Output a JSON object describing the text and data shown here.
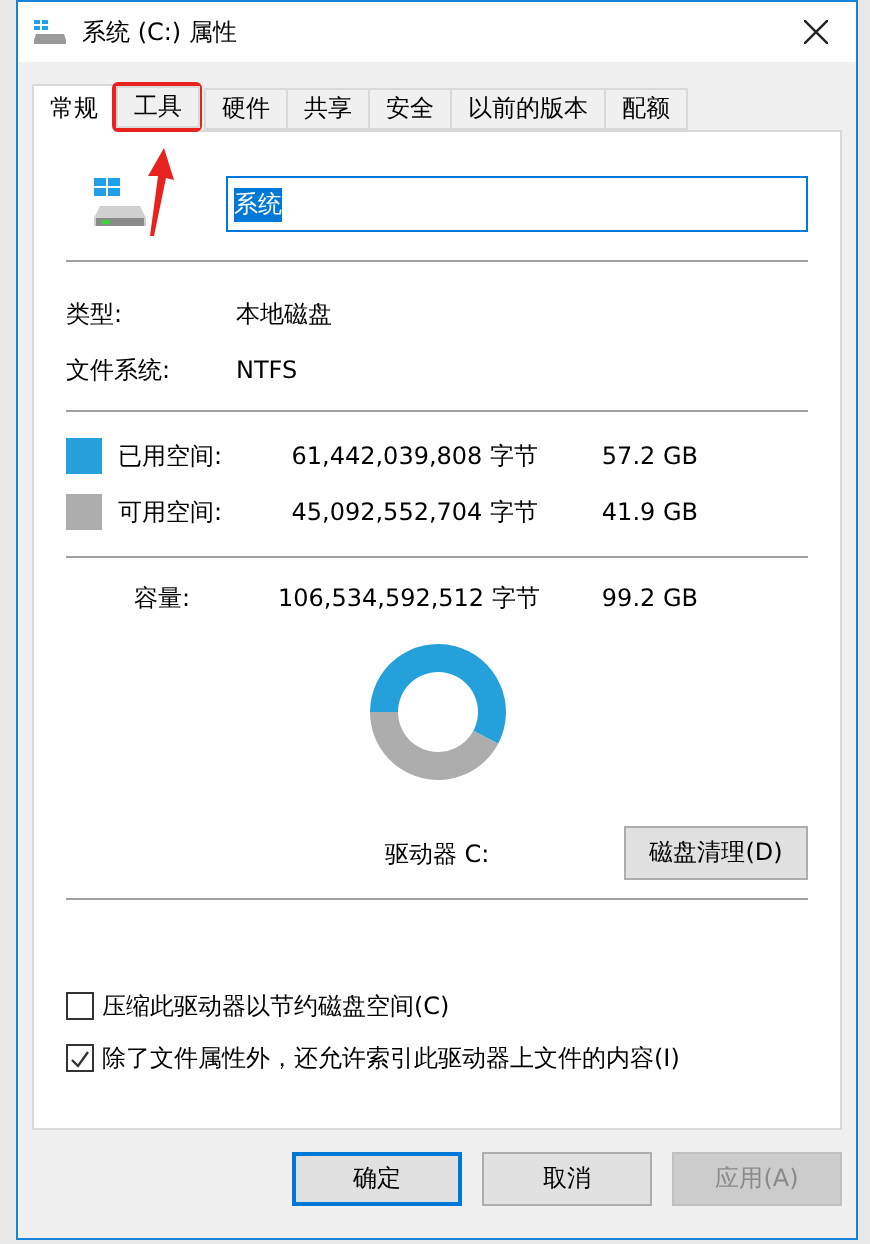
{
  "window": {
    "title": "系统 (C:) 属性"
  },
  "tabs": [
    {
      "label": "常规",
      "selected": true,
      "highlighted": false
    },
    {
      "label": "工具",
      "selected": false,
      "highlighted": true
    },
    {
      "label": "硬件",
      "selected": false,
      "highlighted": false
    },
    {
      "label": "共享",
      "selected": false,
      "highlighted": false
    },
    {
      "label": "安全",
      "selected": false,
      "highlighted": false
    },
    {
      "label": "以前的版本",
      "selected": false,
      "highlighted": false
    },
    {
      "label": "配额",
      "selected": false,
      "highlighted": false
    }
  ],
  "drive_name": {
    "value": "系统"
  },
  "info": [
    {
      "label": "类型:",
      "value": "本地磁盘"
    },
    {
      "label": "文件系统:",
      "value": "NTFS"
    }
  ],
  "space": [
    {
      "label": "已用空间:",
      "bytes": "61,442,039,808 字节",
      "size": "57.2 GB",
      "color": "#26a0da"
    },
    {
      "label": "可用空间:",
      "bytes": "45,092,552,704 字节",
      "size": "41.9 GB",
      "color": "#adadad"
    }
  ],
  "capacity": {
    "label": "容量:",
    "bytes": "106,534,592,512 字节",
    "size": "99.2 GB"
  },
  "usage_ring": {
    "chart_data": {
      "type": "donut",
      "values": [
        57.2,
        41.9
      ]
    }
  },
  "drive_label": "驱动器 C:",
  "cleanup_button": "磁盘清理(D)",
  "options": [
    {
      "label": "压缩此驱动器以节约磁盘空间(C)",
      "checked": false
    },
    {
      "label": "除了文件属性外，还允许索引此驱动器上文件的内容(I)",
      "checked": true
    }
  ],
  "buttons": [
    {
      "label": "确定",
      "kind": "default",
      "disabled": false
    },
    {
      "label": "取消",
      "kind": "normal",
      "disabled": false
    },
    {
      "label": "应用(A)",
      "kind": "normal",
      "disabled": true
    }
  ]
}
